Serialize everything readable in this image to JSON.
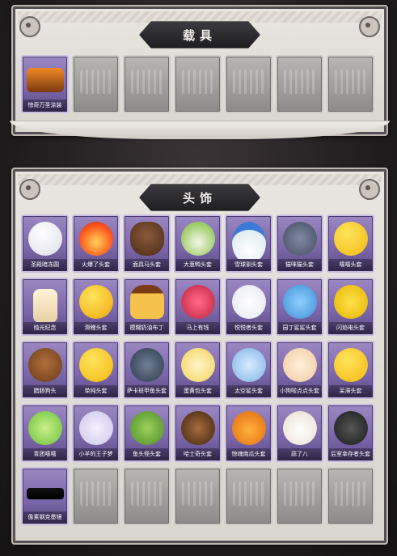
{
  "vehicle_section": {
    "title": "载具",
    "items": [
      {
        "label": "惊奇万圣涂装",
        "filled": true,
        "icon": "halloween-truck-icon"
      },
      {
        "filled": false
      },
      {
        "filled": false
      },
      {
        "filled": false
      },
      {
        "filled": false
      },
      {
        "filled": false
      },
      {
        "filled": false
      }
    ]
  },
  "headwear_section": {
    "title": "头饰",
    "items": [
      {
        "label": "圣殿暗冻圆",
        "filled": true,
        "icon": "white-blob-icon"
      },
      {
        "label": "火爆了头套",
        "filled": true,
        "icon": "fire-face-icon"
      },
      {
        "label": "面具马头套",
        "filled": true,
        "icon": "horse-head-icon"
      },
      {
        "label": "大葱鸭头套",
        "filled": true,
        "icon": "scallion-head-icon"
      },
      {
        "label": "雪球驯头套",
        "filled": true,
        "icon": "snowman-head-icon"
      },
      {
        "label": "猫咪猫头套",
        "filled": true,
        "icon": "grey-cat-icon"
      },
      {
        "label": "嘻嘻头套",
        "filled": true,
        "icon": "grin-emoji-icon"
      },
      {
        "label": "烛光纪念",
        "filled": true,
        "icon": "candle-icon"
      },
      {
        "label": "滑稽头套",
        "filled": true,
        "icon": "smirk-emoji-icon"
      },
      {
        "label": "模糊奶油布丁",
        "filled": true,
        "icon": "pudding-icon"
      },
      {
        "label": "马上有钱",
        "filled": true,
        "icon": "red-horse-icon"
      },
      {
        "label": "悦悦者头套",
        "filled": true,
        "icon": "cloud-head-icon"
      },
      {
        "label": "园丁鲨鲨头套",
        "filled": true,
        "icon": "shark-head-icon"
      },
      {
        "label": "闪焰电头套",
        "filled": true,
        "icon": "electric-mouse-icon"
      },
      {
        "label": "腊肠狗头",
        "filled": true,
        "icon": "dachshund-icon"
      },
      {
        "label": "单纯头套",
        "filled": true,
        "icon": "plain-emoji-icon"
      },
      {
        "label": "萨卡班甲鱼头套",
        "filled": true,
        "icon": "fish-head-icon"
      },
      {
        "label": "蛋黄包头套",
        "filled": true,
        "icon": "egg-yolk-icon"
      },
      {
        "label": "太空鲨头套",
        "filled": true,
        "icon": "space-shark-icon"
      },
      {
        "label": "小狗啦点点头套",
        "filled": true,
        "icon": "dizzy-face-icon"
      },
      {
        "label": "呆滞头套",
        "filled": true,
        "icon": "stare-emoji-icon"
      },
      {
        "label": "青团嘻嘻",
        "filled": true,
        "icon": "green-bun-icon"
      },
      {
        "label": "小羊的王子梦",
        "filled": true,
        "icon": "sheep-prince-icon"
      },
      {
        "label": "鱼头怪头套",
        "filled": true,
        "icon": "fish-monster-icon"
      },
      {
        "label": "哈士奇头套",
        "filled": true,
        "icon": "dog-sunglasses-icon"
      },
      {
        "label": "惊魂南瓜头套",
        "filled": true,
        "icon": "pumpkin-icon"
      },
      {
        "label": "蒜了八",
        "filled": true,
        "icon": "garlic-icon"
      },
      {
        "label": "后室幸存者头套",
        "filled": true,
        "icon": "gas-mask-icon"
      },
      {
        "label": "像素钢克墨镜",
        "filled": true,
        "icon": "pixel-sunglasses-icon"
      },
      {
        "filled": false
      },
      {
        "filled": false
      },
      {
        "filled": false
      },
      {
        "filled": false
      },
      {
        "filled": false
      },
      {
        "filled": false
      }
    ]
  }
}
